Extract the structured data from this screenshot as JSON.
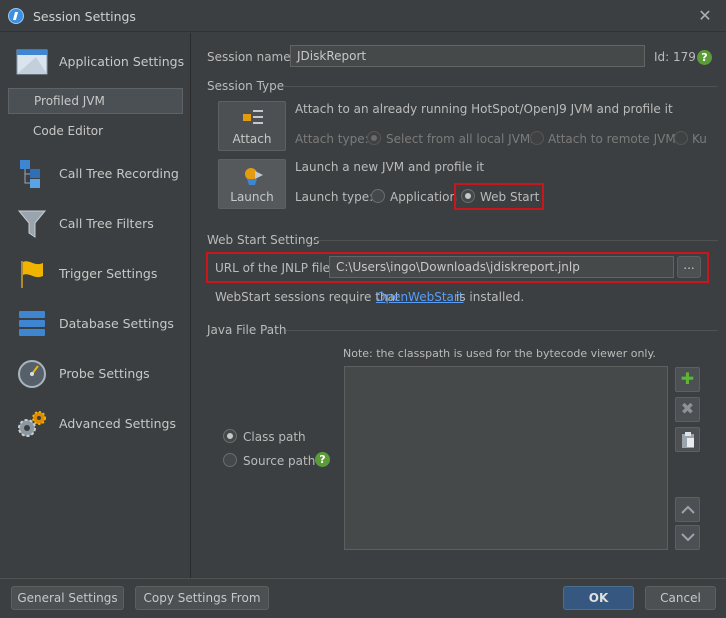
{
  "window": {
    "title": "Session Settings",
    "close_glyph": "✕"
  },
  "sidebar": {
    "items": [
      {
        "label": "Application Settings",
        "icon": "application-settings-icon"
      },
      {
        "label": "Profiled JVM",
        "selected": true
      },
      {
        "label": "Code Editor"
      },
      {
        "label": "Call Tree Recording",
        "icon": "call-tree-recording-icon"
      },
      {
        "label": "Call Tree Filters",
        "icon": "funnel-icon"
      },
      {
        "label": "Trigger Settings",
        "icon": "flag-icon"
      },
      {
        "label": "Database Settings",
        "icon": "database-icon"
      },
      {
        "label": "Probe Settings",
        "icon": "gauge-icon"
      },
      {
        "label": "Advanced Settings",
        "icon": "gears-icon"
      }
    ]
  },
  "session": {
    "name_label": "Session name:",
    "name_value": "JDiskReport",
    "id_label": "Id:",
    "id_value": "179",
    "help": "?"
  },
  "session_type": {
    "title": "Session Type",
    "attach": {
      "button_label": "Attach",
      "description": "Attach to an already running HotSpot/OpenJ9 JVM and profile it",
      "type_label": "Attach type:",
      "options": [
        "Select from all local JVMs",
        "Attach to remote JVM",
        "Ku"
      ]
    },
    "launch": {
      "button_label": "Launch",
      "description": "Launch a new JVM and profile it",
      "type_label": "Launch type:",
      "options": [
        "Application",
        "Web Start"
      ],
      "selected": "Web Start"
    }
  },
  "web_start": {
    "title": "Web Start Settings",
    "url_label": "URL of the JNLP file:",
    "url_value": "C:\\Users\\ingo\\Downloads\\jdiskreport.jnlp",
    "browse_label": "...",
    "note_prefix": "WebStart sessions require that",
    "note_link": "OpenWebStart",
    "note_suffix": "is installed."
  },
  "java_file_path": {
    "title": "Java File Path",
    "note": "Note: the classpath is used for the bytecode viewer only.",
    "options": [
      "Class path",
      "Source path"
    ],
    "selected": "Class path",
    "help": "?"
  },
  "buttons": {
    "general": "General Settings",
    "copy": "Copy Settings From",
    "ok": "OK",
    "cancel": "Cancel"
  },
  "colors": {
    "accent": "#589df6",
    "highlight": "#c8161d",
    "ok": "#365880"
  }
}
